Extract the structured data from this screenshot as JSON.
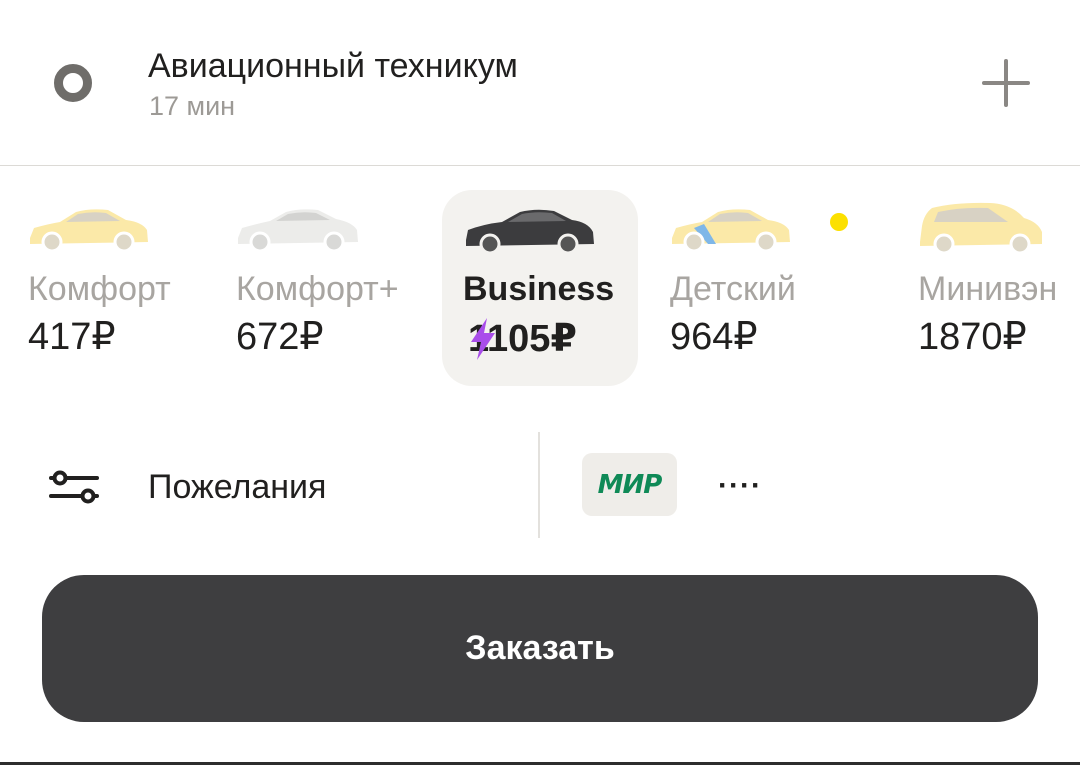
{
  "destination": {
    "title": "Авиационный техникум",
    "eta": "17 мин",
    "add_icon": "plus-icon"
  },
  "tariffs": [
    {
      "name": "Комфорт",
      "price": "417₽",
      "car_color": "#fbe9a8",
      "selected": false
    },
    {
      "name": "Комфорт+",
      "price": "672₽",
      "car_color": "#ececea",
      "selected": false
    },
    {
      "name": "Business",
      "price": "1105₽",
      "car_color": "#3c3c3e",
      "selected": true,
      "surge_icon": "lightning-icon",
      "surge_color": "#a94dea"
    },
    {
      "name": "Детский",
      "price": "964₽",
      "car_color": "#fbe9a8",
      "selected": false
    },
    {
      "name": "Минивэн",
      "price": "1870₽",
      "car_color": "#fbe9a8",
      "selected": false
    }
  ],
  "options": {
    "wishes_label": "Пожелания",
    "wishes_icon": "filter-sliders-icon",
    "payment": {
      "system": "МИР",
      "system_color": "#0f8a57",
      "masked_number": "····"
    }
  },
  "order_button": {
    "label": "Заказать",
    "color": "#3e3e40"
  },
  "colors": {
    "accent_yellow": "#fce000",
    "muted_text": "#a8a5a1"
  }
}
